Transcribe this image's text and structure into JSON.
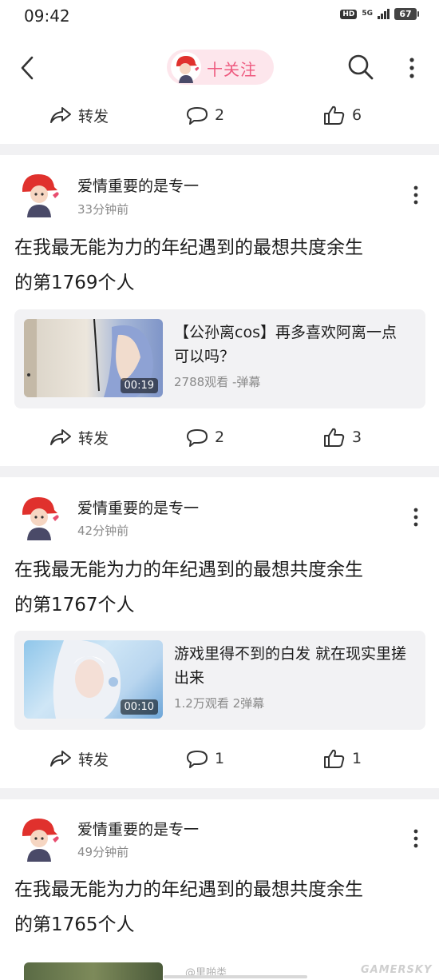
{
  "status_bar": {
    "time": "09:42",
    "hd": "HD",
    "network": "5G",
    "battery": "67"
  },
  "nav": {
    "back_icon": "chevron-left-icon",
    "follow_label": "十关注",
    "search_icon": "search-icon",
    "more_icon": "more-vertical-icon"
  },
  "top_actions": {
    "repost_label": "转发",
    "comment_count": "2",
    "like_count": "6"
  },
  "posts": [
    {
      "author": "爱情重要的是专一",
      "time": "33分钟前",
      "text_line1": "在我最无能为力的年纪遇到的最想共度余生",
      "text_line2": "的第1769个人",
      "video": {
        "duration": "00:19",
        "title": "【公孙离cos】再多喜欢阿离一点 可以吗？",
        "meta": "2788观看 -弹幕"
      },
      "repost_label": "转发",
      "comment_count": "2",
      "like_count": "3"
    },
    {
      "author": "爱情重要的是专一",
      "time": "42分钟前",
      "text_line1": "在我最无能为力的年纪遇到的最想共度余生",
      "text_line2": "的第1767个人",
      "video": {
        "duration": "00:10",
        "title": "游戏里得不到的白发 就在现实里搓出来",
        "meta": "1.2万观看 2弹幕"
      },
      "repost_label": "转发",
      "comment_count": "1",
      "like_count": "1"
    },
    {
      "author": "爱情重要的是专一",
      "time": "49分钟前",
      "text_line1": "在我最无能为力的年纪遇到的最想共度余生",
      "text_line2": "的第1765个人"
    }
  ],
  "watermark": {
    "handle": "@里啪类",
    "logo": "GAMERSKY"
  },
  "colors": {
    "accent_pink": "#ee5a7f",
    "pill_bg": "#fde6ec",
    "divider": "#f1f1f3",
    "card_bg": "#f2f2f4"
  }
}
